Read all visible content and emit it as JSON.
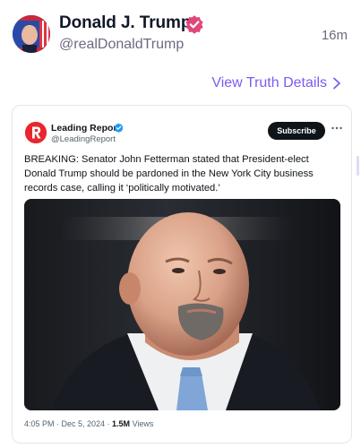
{
  "post": {
    "display_name": "Donald J. Trump",
    "handle": "@realDonaldTrump",
    "time_ago": "16m",
    "view_details": "View Truth Details",
    "verified_color": "#e0467c",
    "link_color": "#7c5cf0"
  },
  "quoted": {
    "account_name": "Leading Report",
    "account_handle": "@LeadingReport",
    "subscribe_label": "Subscribe",
    "more_label": "···",
    "text": "BREAKING: Senator John Fetterman stated that President-elect Donald Trump should be pardoned in the New York City business records case, calling it ‘politically motivated.’",
    "date": "4:05 PM · Dec 5, 2024 · ",
    "views_count": "1.5M",
    "views_label": " Views",
    "brand_color": "#e8262d",
    "check_color": "#1d9bf0"
  }
}
